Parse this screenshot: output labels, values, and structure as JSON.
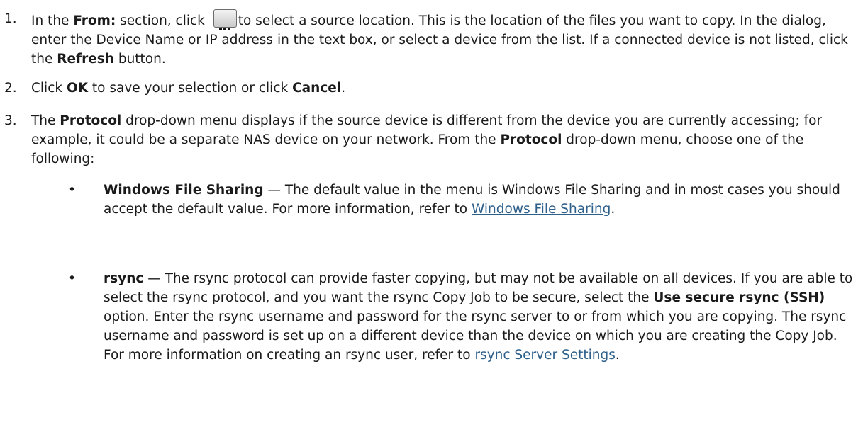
{
  "steps": {
    "s1": {
      "num": "1.",
      "a": "In the ",
      "from": "From:",
      "b": " section, click ",
      "c": "to select a source location. This is the location of the files you want to copy. In the dialog, enter the Device Name or IP address in the text box, or select a device from the list. If a connected device is not listed, click the ",
      "refresh": "Refresh",
      "d": " button."
    },
    "s2": {
      "num": "2.",
      "a": "Click ",
      "ok": "OK",
      "b": " to save your selection or click ",
      "cancel": "Cancel",
      "c": "."
    },
    "s3": {
      "num": "3.",
      "a": "The ",
      "protocol1": "Protocol",
      "b": " drop-down menu displays if the source device is different from the device you are currently accessing; for example, it could be a separate NAS device on your network. From the ",
      "protocol2": "Protocol",
      "c": " drop-down menu, choose one of the following:"
    }
  },
  "bullets": {
    "b1": {
      "mark": "•",
      "term": "Windows File Sharing",
      "a": " — The default value in the menu is Windows File Sharing and in most cases you should accept the default value. For more information, refer to ",
      "link": "Windows File Sharing",
      "b": "."
    },
    "b2": {
      "mark": "•",
      "term": "rsync",
      "a": " — The rsync protocol can provide faster copying, but may not be available on all devices. If you are able to select the rsync protocol, and you want the rsync Copy Job to be secure, select the ",
      "option": "Use secure rsync (SSH)",
      "b": " option. Enter the rsync username and password for the rsync server to or from which you are copying. The rsync username and password is set up on a different device than the device on which you are creating the Copy Job. For more information on creating an rsync user, refer to ",
      "link": "rsync Server Settings",
      "c": "."
    }
  },
  "colors": {
    "link": "#2d5f8b",
    "text": "#1a1a1a"
  },
  "icons": {
    "browse_button": "ellipsis-browse-button"
  }
}
